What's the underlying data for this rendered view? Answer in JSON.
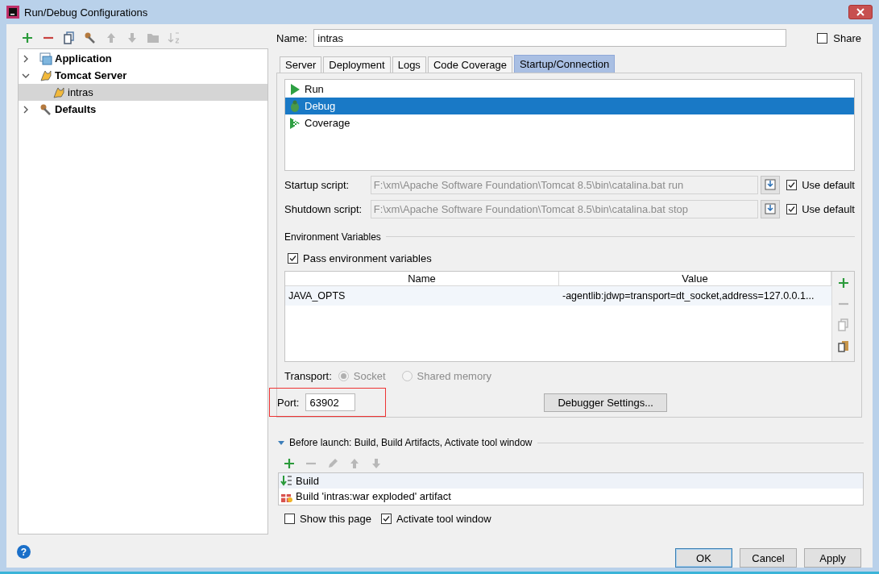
{
  "window": {
    "title": "Run/Debug Configurations"
  },
  "toolbar": [
    {
      "kind": "add",
      "disabled": false
    },
    {
      "kind": "remove",
      "disabled": false
    },
    {
      "kind": "copy",
      "disabled": false
    },
    {
      "kind": "wrench",
      "disabled": false
    },
    {
      "kind": "up",
      "disabled": true
    },
    {
      "kind": "down",
      "disabled": true
    },
    {
      "kind": "folder",
      "disabled": true
    },
    {
      "kind": "sort",
      "disabled": true
    }
  ],
  "tree": [
    {
      "label": "Application",
      "kind": "application",
      "expanded": false,
      "selected": false
    },
    {
      "label": "Tomcat Server",
      "kind": "tomcat",
      "expanded": true,
      "selected": false,
      "children": [
        {
          "label": "intras",
          "kind": "tomcat",
          "selected": true
        }
      ]
    },
    {
      "label": "Defaults",
      "kind": "wrench",
      "expanded": false,
      "selected": false
    }
  ],
  "name": {
    "label": "Name:",
    "value": "intras"
  },
  "share": {
    "label": "Share",
    "checked": false
  },
  "tabs": [
    {
      "label": "Server",
      "selected": false
    },
    {
      "label": "Deployment",
      "selected": false
    },
    {
      "label": "Logs",
      "selected": false
    },
    {
      "label": "Code Coverage",
      "selected": false
    },
    {
      "label": "Startup/Connection",
      "selected": true
    }
  ],
  "modes": [
    {
      "label": "Run",
      "kind": "run",
      "selected": false
    },
    {
      "label": "Debug",
      "kind": "debug",
      "selected": true
    },
    {
      "label": "Coverage",
      "kind": "coverage",
      "selected": false
    }
  ],
  "scripts": [
    {
      "label": "Startup script:",
      "value": "F:\\xm\\Apache Software Foundation\\Tomcat 8.5\\bin\\catalina.bat run",
      "default_label": "Use default",
      "use_default": true
    },
    {
      "label": "Shutdown script:",
      "value": "F:\\xm\\Apache Software Foundation\\Tomcat 8.5\\bin\\catalina.bat stop",
      "default_label": "Use default",
      "use_default": true
    }
  ],
  "environment": {
    "title": "Environment Variables",
    "pass_label": "Pass environment variables",
    "pass": true,
    "columns": [
      "Name",
      "Value"
    ],
    "rows": [
      {
        "name": "JAVA_OPTS",
        "value": "-agentlib:jdwp=transport=dt_socket,address=127.0.0.1..."
      }
    ],
    "tools": [
      {
        "kind": "add",
        "disabled": false
      },
      {
        "kind": "remove",
        "disabled": true
      },
      {
        "kind": "copy",
        "disabled": true
      },
      {
        "kind": "paste",
        "disabled": false
      }
    ]
  },
  "transport": {
    "label": "Transport:",
    "options": [
      {
        "label": "Socket",
        "selected": true,
        "disabled": true
      },
      {
        "label": "Shared memory",
        "selected": false,
        "disabled": true
      }
    ]
  },
  "port": {
    "label": "Port:",
    "value": "63902",
    "highlighted": true
  },
  "debugger_settings": "Debugger Settings...",
  "before_launch": {
    "title": "Before launch: Build, Build Artifacts, Activate tool window",
    "expanded": true,
    "tools": [
      {
        "kind": "add",
        "disabled": false
      },
      {
        "kind": "remove",
        "disabled": true
      },
      {
        "kind": "edit",
        "disabled": true
      },
      {
        "kind": "up",
        "disabled": true
      },
      {
        "kind": "down",
        "disabled": true
      }
    ],
    "tasks": [
      {
        "label": "Build",
        "kind": "build",
        "selected": true
      },
      {
        "label": "Build 'intras:war exploded' artifact",
        "kind": "artifact",
        "selected": false
      }
    ]
  },
  "options": [
    {
      "label": "Show this page",
      "checked": false
    },
    {
      "label": "Activate tool window",
      "checked": true
    }
  ],
  "help": "?",
  "buttons": [
    {
      "label": "OK",
      "default": true
    },
    {
      "label": "Cancel",
      "default": false
    },
    {
      "label": "Apply",
      "default": false
    }
  ]
}
